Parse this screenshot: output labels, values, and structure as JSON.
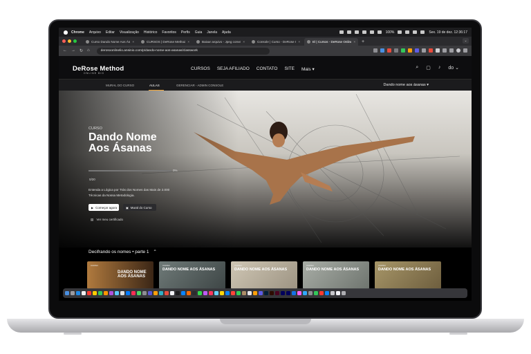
{
  "menubar": {
    "app": "Chrome",
    "items": [
      "Arquivo",
      "Editar",
      "Visualização",
      "Histórico",
      "Favoritos",
      "Perfis",
      "Guia",
      "Janela",
      "Ajuda"
    ],
    "battery": "100%",
    "datetime": "Sex. 19 de dez.  12:36:17"
  },
  "tabs": [
    {
      "label": "Curso Dando Nome Aos Ásan",
      "active": false
    },
    {
      "label": "CURSOS | DeRose Method | ...",
      "active": false
    },
    {
      "label": "Baixar arquivo - Jpeg conver...",
      "active": false
    },
    {
      "label": "Console | Curso - DeRose I...",
      "active": false
    },
    {
      "label": "El | Cursos - DeRose Online",
      "active": true
    }
  ],
  "newtab": "+",
  "address": {
    "url": "derosoonlinelio.ansinio.com/p/dando-nome-aos-asanas/classwork"
  },
  "site": {
    "logo": "DeRose Method",
    "logo_sub": "ONLINE  BIG",
    "nav": [
      "CURSOS",
      "SEJA AFILIADO",
      "CONTATO",
      "SITE",
      "Mais ▾"
    ],
    "user": "do ⌄"
  },
  "subnav": {
    "items": [
      "MURAL DO CURSO",
      "AULAS",
      "GERENCIAR - ADMIN CONSOLE"
    ],
    "active": "AULAS",
    "course_select": "Dando nome aos ásanas  ▾"
  },
  "hero": {
    "eyebrow": "CURSO",
    "title_line1": "Dando Nome",
    "title_line2": "Aos Ásanas",
    "progress_label": "0%",
    "progress": 0,
    "count": "0/20",
    "description": "Entenda a Lógica por Trás dos Nomes das Mais de 2.000 Técnicas da Nossa Metodologia.",
    "primary_button": "Começar agora",
    "secondary_button": "Mural do Curso",
    "certificate_link": "Ver meu certificado"
  },
  "section": {
    "title": "Decifrando os nomes • parte 1",
    "toggle": "⌃",
    "cards": [
      {
        "eyebrow": "CURSO",
        "title": "DANDO NOME AOS ÁSANAS",
        "bg": "#7a4a22"
      },
      {
        "eyebrow": "CURSO",
        "title": "DANDO NOME AOS ÁSANAS",
        "bg": "#5a6a6a"
      },
      {
        "eyebrow": "CURSO",
        "title": "DANDO NOME AOS ÁSANAS",
        "bg": "#b6ad9c"
      },
      {
        "eyebrow": "CURSO",
        "title": "DANDO NOME AOS ÁSANAS",
        "bg": "#8f9690"
      },
      {
        "eyebrow": "CURSO",
        "title": "DANDO NOME AOS ÁSANAS",
        "bg": "#8b7a58"
      }
    ]
  },
  "colors": {
    "accent": "#f2a83b",
    "header_bg": "#0d0d0f"
  }
}
